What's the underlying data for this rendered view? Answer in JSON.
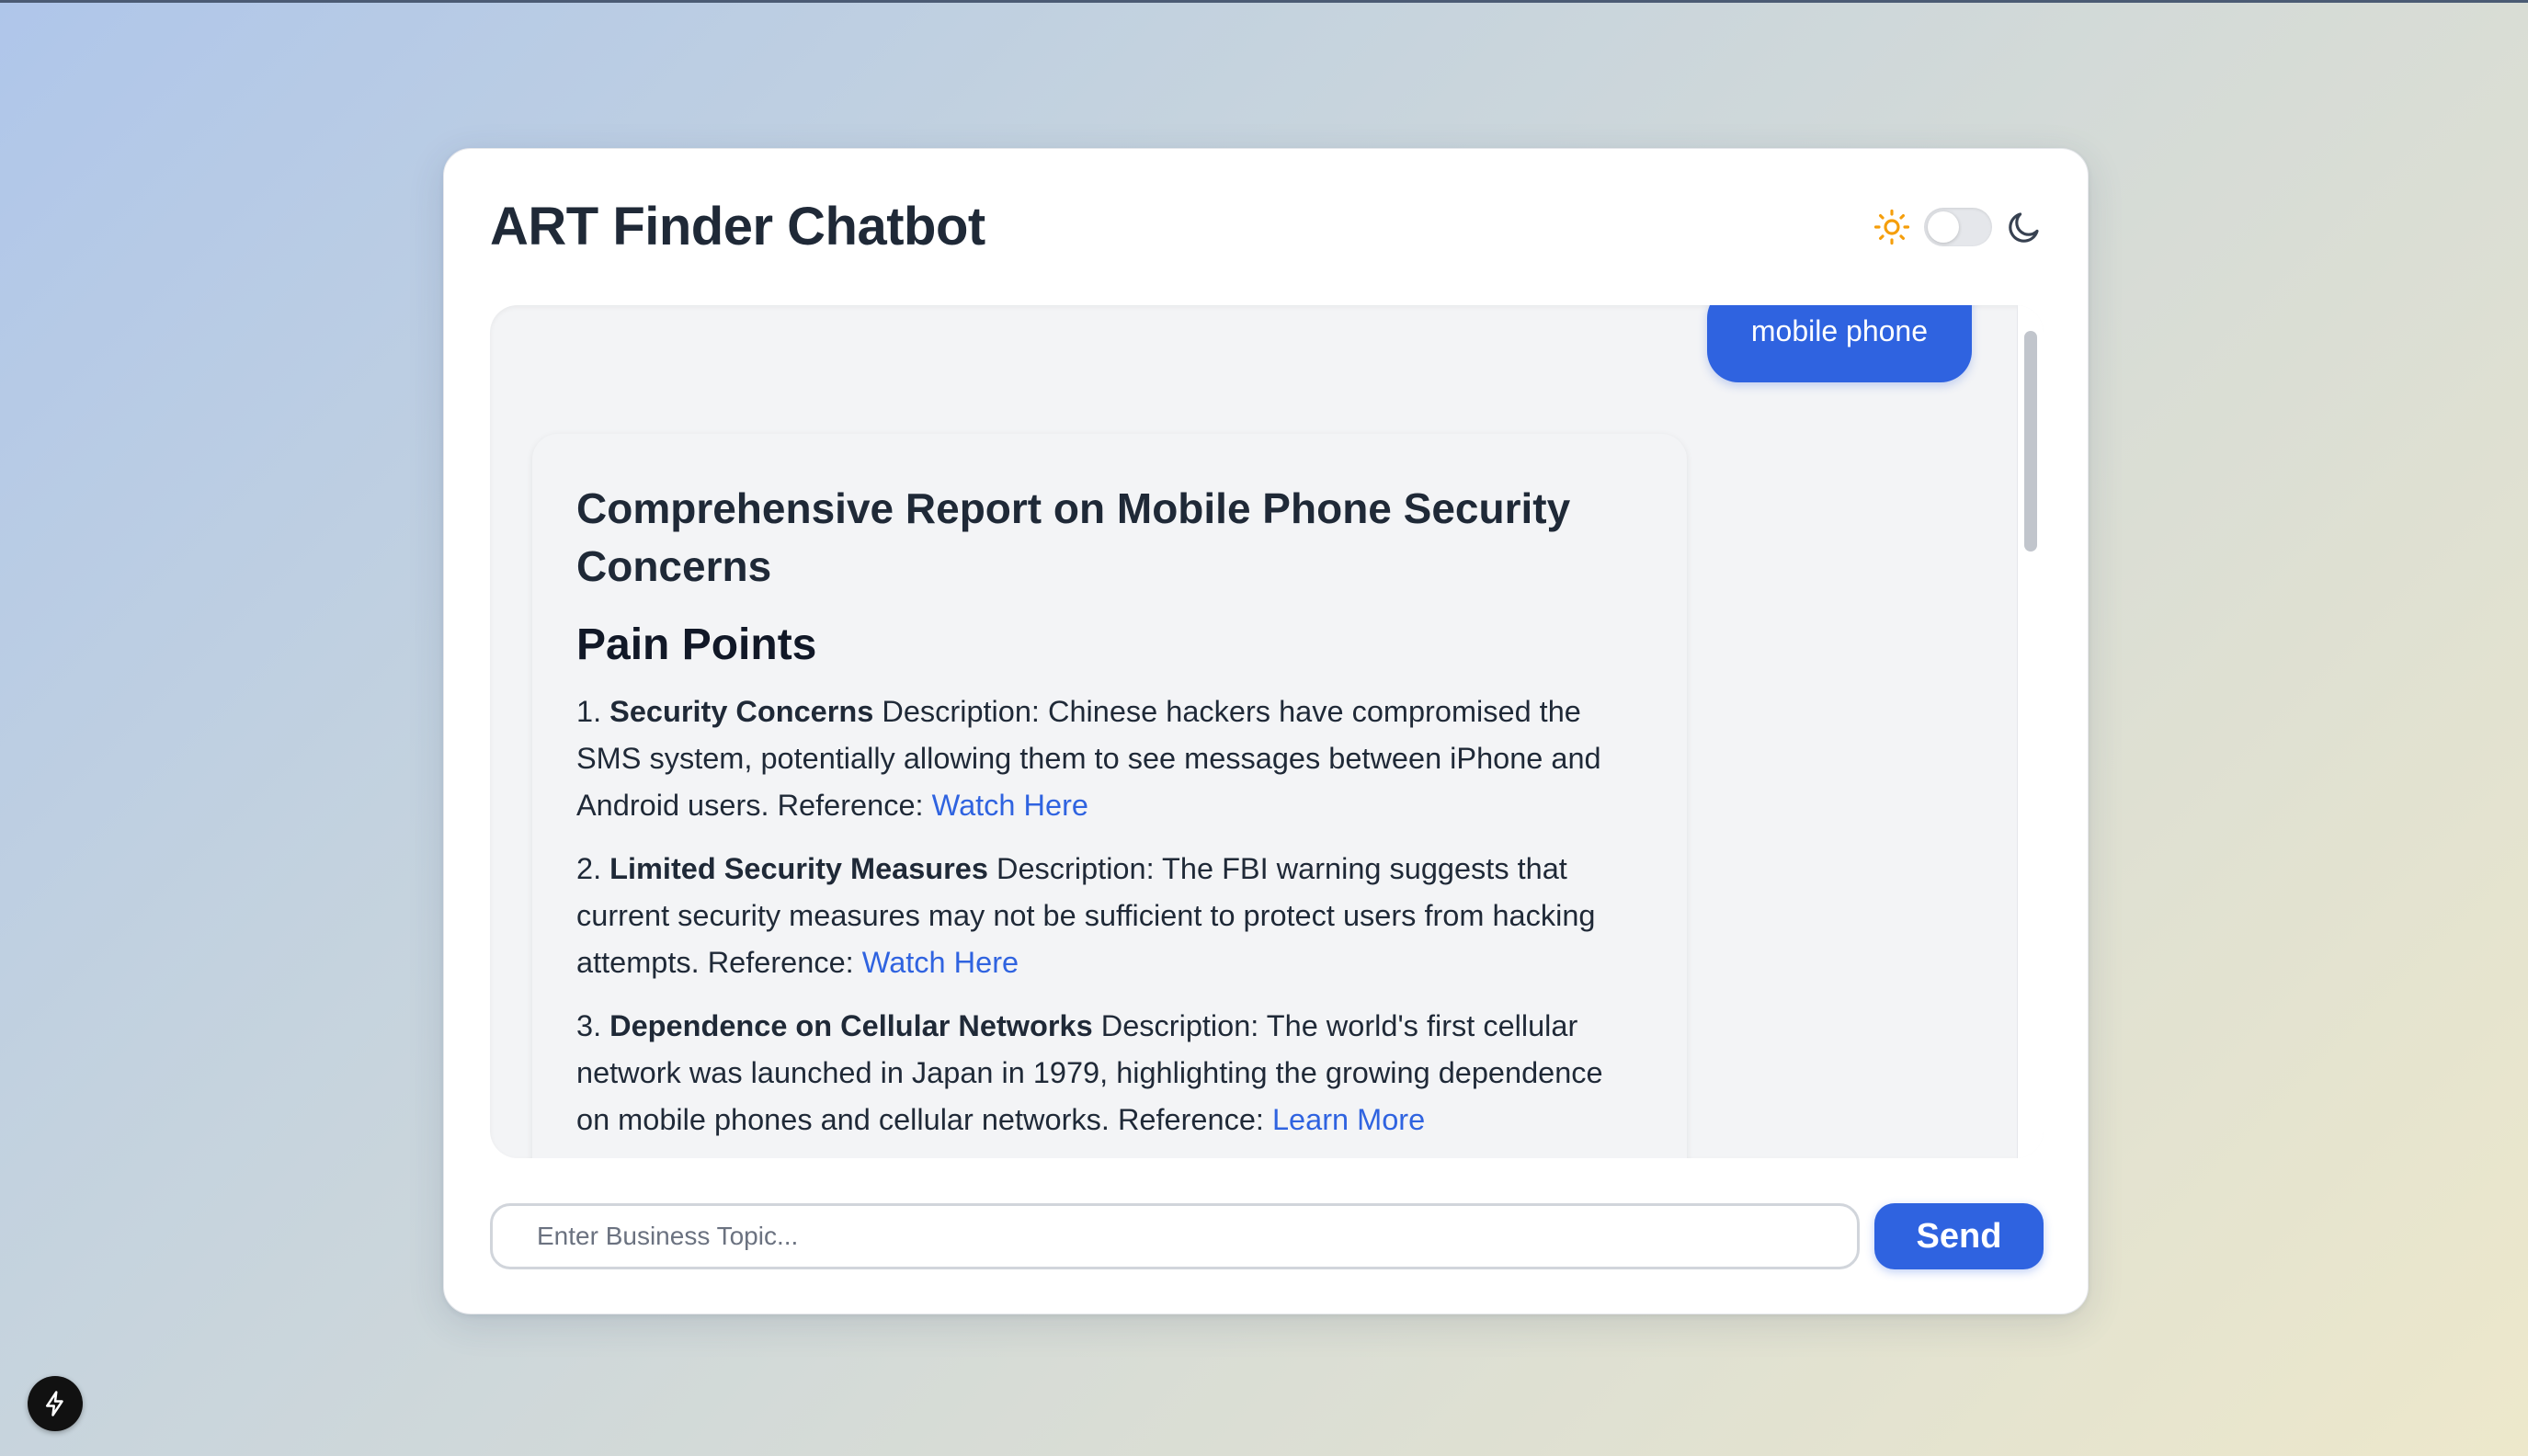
{
  "app": {
    "title": "ART Finder Chatbot"
  },
  "theme": {
    "light_icon": "sun-icon",
    "dark_icon": "moon-icon",
    "mode": "light"
  },
  "chat": {
    "user_message": "mobile phone",
    "report": {
      "title": "Comprehensive Report on Mobile Phone Security Concerns",
      "section": "Pain Points",
      "points": [
        {
          "number": "1.",
          "heading": "Security Concerns",
          "description": "Description: Chinese hackers have compromised the SMS system, potentially allowing them to see messages between iPhone and Android users. Reference:",
          "link": "Watch Here"
        },
        {
          "number": "2.",
          "heading": "Limited Security Measures",
          "description": "Description: The FBI warning suggests that current security measures may not be sufficient to protect users from hacking attempts. Reference:",
          "link": "Watch Here"
        },
        {
          "number": "3.",
          "heading": "Dependence on Cellular Networks",
          "description": "Description: The world's first cellular network was launched in Japan in 1979, highlighting the growing dependence on mobile phones and cellular networks. Reference:",
          "link": "Learn More"
        }
      ]
    }
  },
  "input": {
    "placeholder": "Enter Business Topic...",
    "value": ""
  },
  "send_button": {
    "label": "Send"
  },
  "colors": {
    "accent": "#2f63e0",
    "sun": "#f59e0b",
    "text": "#1f2937"
  },
  "dev_badge": {
    "icon": "lightning-bolt-icon"
  }
}
